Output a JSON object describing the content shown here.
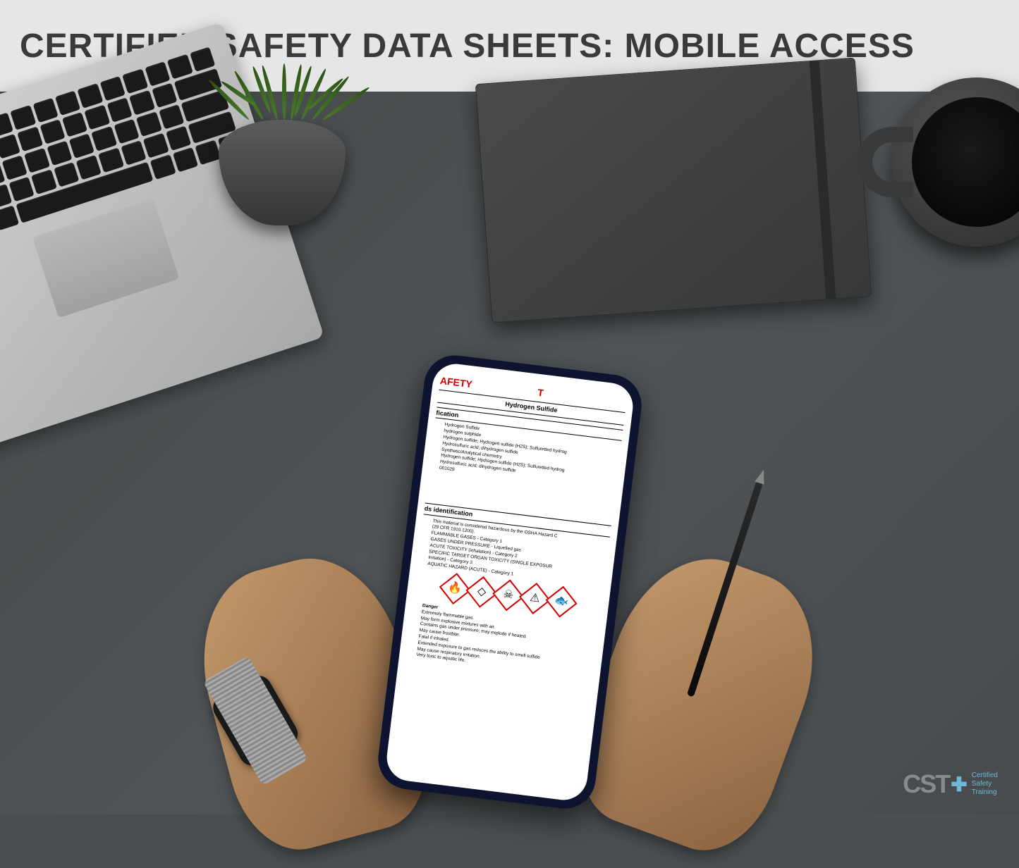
{
  "header": {
    "title": "CERTIFIED SAFETY DATA SHEETS: MOBILE ACCESS"
  },
  "phone_sds": {
    "doc_title_fragment": "AFETY",
    "doc_title_suffix": "T",
    "chemical_name": "Hydrogen Sulfide",
    "section1_heading": "fication",
    "section1_lines": [
      "Hydrogen Sulfide",
      "hydrogen sulphide",
      "Hydrogen sulfide; Hydrogen sulfide (H2S); Sulfuretted hydrog",
      "Hydrosulfuric acid; dihydrogen sulfide",
      "Synthetic/Analytical chemistry.",
      "Hydrogen sulfide; Hydrogen sulfide (H2S); Sulfuretted hydrog",
      "Hydrosulfuric acid; dihydrogen sulfide",
      "001029"
    ],
    "section2_heading": "ds identification",
    "section2_lines": [
      "This material is considered hazardous by the OSHA Hazard C",
      "(29 CFR 1910.1200).",
      "FLAMMABLE GASES - Category 1",
      "GASES UNDER PRESSURE - Liquefied gas",
      "ACUTE TOXICITY (inhalation) - Category 2",
      "SPECIFIC TARGET ORGAN TOXICITY (SINGLE EXPOSUR",
      "irritation) - Category 3",
      "AQUATIC HAZARD (ACUTE) - Category 1"
    ],
    "signal_word": "Danger",
    "hazard_statements": [
      "Extremely flammable gas.",
      "May form explosive mixtures with air.",
      "Contains gas under pressure; may explode if heated.",
      "May cause frostbite.",
      "Fatal if inhaled.",
      "Extended exposure to gas reduces the ability to smell sulfide",
      "May cause respiratory irritation.",
      "Very toxic to aquatic life."
    ],
    "ghs_icons": [
      "🔥",
      "◇",
      "☠",
      "⚠",
      "🐟"
    ]
  },
  "logo": {
    "abbrev": "CST",
    "plus": "✚",
    "line1": "Certified",
    "line2": "Safety",
    "line3": "Training"
  }
}
